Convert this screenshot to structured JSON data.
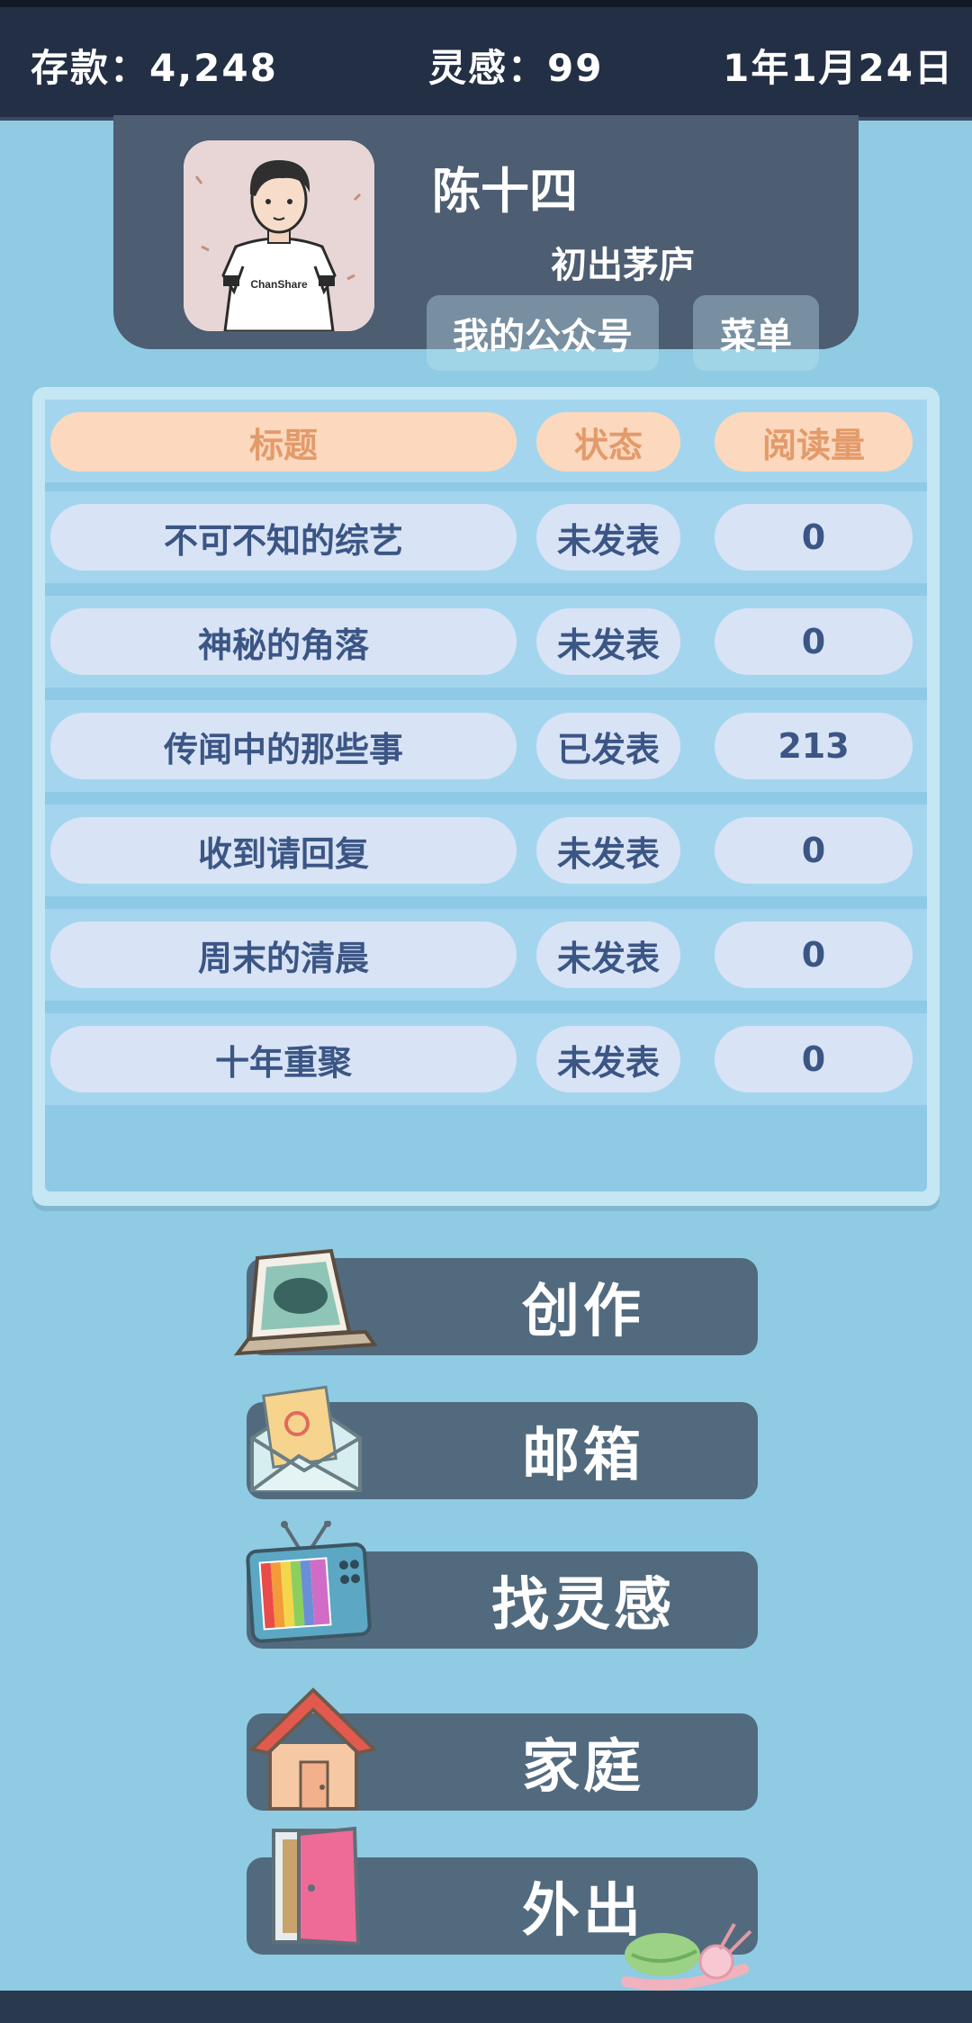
{
  "topbar": {
    "savings": "存款：4,248",
    "inspiration": "灵感：99",
    "date": "1年1月24日"
  },
  "profile": {
    "name": "陈十四",
    "rank": "初出茅庐",
    "account_button": "我的公众号",
    "menu_button": "菜单",
    "avatar_shirt_text": "ChanShare"
  },
  "table": {
    "headers": {
      "title": "标题",
      "status": "状态",
      "reads": "阅读量"
    },
    "rows": [
      {
        "title": "不可不知的综艺",
        "status": "未发表",
        "reads": "0"
      },
      {
        "title": "神秘的角落",
        "status": "未发表",
        "reads": "0"
      },
      {
        "title": "传闻中的那些事",
        "status": "已发表",
        "reads": "213"
      },
      {
        "title": "收到请回复",
        "status": "未发表",
        "reads": "0"
      },
      {
        "title": "周末的清晨",
        "status": "未发表",
        "reads": "0"
      },
      {
        "title": "十年重聚",
        "status": "未发表",
        "reads": "0"
      }
    ]
  },
  "actions": {
    "create": {
      "label": "创作",
      "icon": "laptop-icon"
    },
    "mailbox": {
      "label": "邮箱",
      "icon": "envelope-icon"
    },
    "inspiration": {
      "label": "找灵感",
      "icon": "tv-icon"
    },
    "family": {
      "label": "家庭",
      "icon": "house-icon"
    },
    "outing": {
      "label": "外出",
      "icon": "door-icon"
    }
  },
  "colors": {
    "background": "#8fcbe3",
    "topbar": "#232f44",
    "panel": "#4d5d72",
    "action_button": "#526a7e",
    "header_pill": "#fbd8be",
    "row_pill": "#d8e3f5",
    "text_blue": "#3b5685"
  }
}
